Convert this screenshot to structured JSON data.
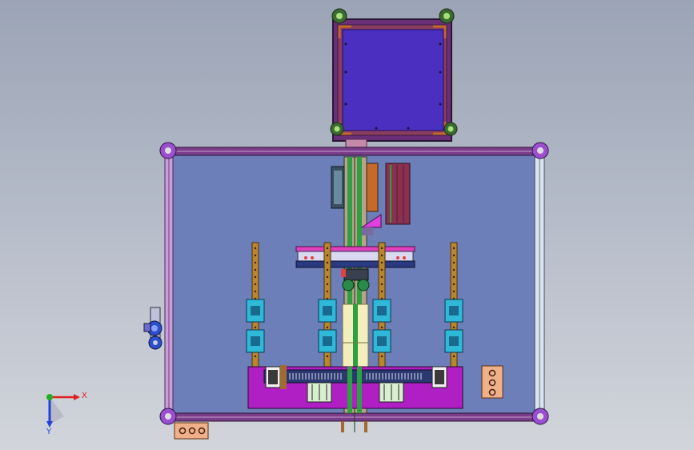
{
  "viewport": {
    "background_top": "#9ba4b6",
    "background_bottom": "#d2d5db"
  },
  "colors": {
    "frame_purple": "#7a3d8a",
    "frame_dark": "#3b2450",
    "panel_blue": "#6c7fb8",
    "top_panel": "#4b2fc0",
    "rail_orange": "#b8862b",
    "bearing_cyan": "#2fb8d8",
    "base_magenta": "#b01fc4",
    "shaft_green": "#2ea043",
    "rod_cream": "#f3efbd",
    "plate_peach": "#f0b08a"
  },
  "triad": {
    "x_label": "X",
    "y_label": "Y",
    "x_color": "#e02020",
    "y_color": "#20b020",
    "z_color": "#2040e0"
  },
  "icons": {
    "corner": "caster-ball-icon",
    "triad": "coordinate-triad-icon"
  }
}
